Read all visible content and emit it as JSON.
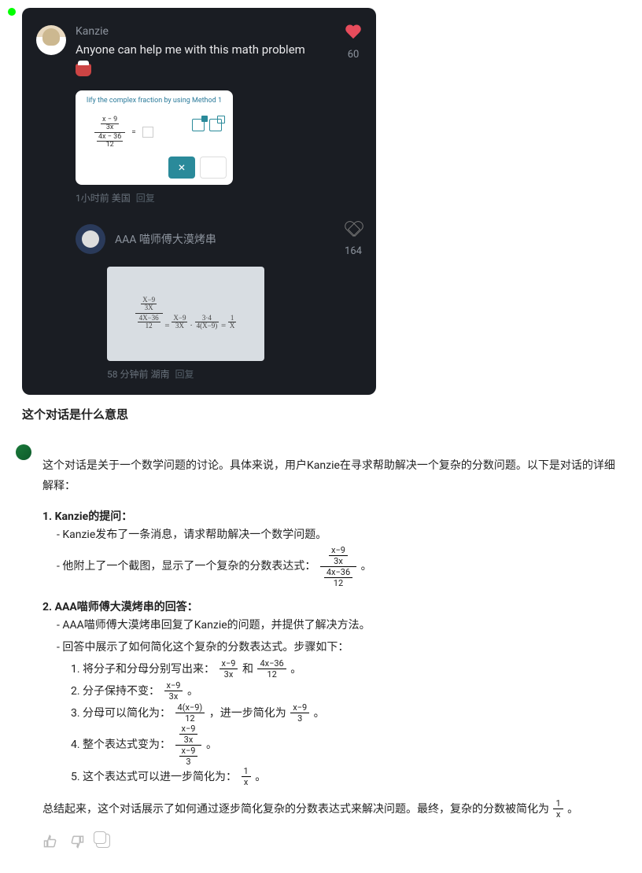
{
  "post": {
    "user": "Kanzie",
    "text": "Anyone can help me with this math problem",
    "likes": "60",
    "image_prompt": "lify the complex fraction by using Method 1",
    "frac_outer_top_num": "x − 9",
    "frac_outer_top_den": "3x",
    "frac_outer_bot_num": "4x − 36",
    "frac_outer_bot_den": "12",
    "eq": "=",
    "btn_x": "×",
    "meta_time": "1小时前",
    "meta_loc": "美国",
    "meta_reply": "回复"
  },
  "reply": {
    "user": "AAA 喵师傅大漠烤串",
    "likes": "164",
    "hand_top_l_n": "X−9",
    "hand_top_l_d": "3X",
    "hand_bot_l_n": "4X−36",
    "hand_bot_l_d": "12",
    "hand_mid": "=",
    "hand_r1_top": "X−9",
    "hand_r1_bot": "3X",
    "hand_dot": "·",
    "hand_r2_top": "3·4",
    "hand_r2_bot": "4(X−9)",
    "hand_eq2": "=",
    "hand_final_top": "1",
    "hand_final_bot": "X",
    "meta_time": "58 分钟前",
    "meta_loc": "湖南",
    "meta_reply": "回复"
  },
  "question": "这个对话是什么意思",
  "answer": {
    "intro": "这个对话是关于一个数学问题的讨论。具体来说，用户Kanzie在寻求帮助解决一个复杂的分数问题。以下是对话的详细解释：",
    "s1_title": "1. Kanzie的提问：",
    "s1_a": "- Kanzie发布了一条消息，请求帮助解决一个数学问题。",
    "s1_b_pre": "- 他附上了一个截图，显示了一个复杂的分数表达式：",
    "s1_b_post": "。",
    "f1_tn": "x−9",
    "f1_td": "3x",
    "f1_bn": "4x−36",
    "f1_bd": "12",
    "s2_title": "2. AAA喵师傅大漠烤串的回答：",
    "s2_a": "- AAA喵师傅大漠烤串回复了Kanzie的问题，并提供了解决方法。",
    "s2_b": "- 回答中展示了如何简化这个复杂的分数表达式。步骤如下：",
    "step1_pre": "1. 将分子和分母分别写出来：",
    "step1_mid": " 和 ",
    "step1_post": "。",
    "f_top_n": "x−9",
    "f_top_d": "3x",
    "f_bot_n": "4x−36",
    "f_bot_d": "12",
    "step2_pre": "2. 分子保持不变：",
    "step2_post": "。",
    "step3_pre": "3. 分母可以简化为：",
    "step3_mid": "，进一步简化为 ",
    "step3_post": "。",
    "f3a_n": "4(x−9)",
    "f3a_d": "12",
    "f3b_n": "x−9",
    "f3b_d": "3",
    "step4_pre": "4. 整个表达式变为：",
    "step4_post": "。",
    "f4_tn": "x−9",
    "f4_td": "3x",
    "f4_bn": "x−9",
    "f4_bd": "3",
    "step5_pre": "5. 这个表达式可以进一步简化为：",
    "step5_post": "。",
    "f5_n": "1",
    "f5_d": "x",
    "summary_pre": "总结起来，这个对话展示了如何通过逐步简化复杂的分数表达式来解决问题。最终，复杂的分数被简化为",
    "summary_post": "。"
  }
}
